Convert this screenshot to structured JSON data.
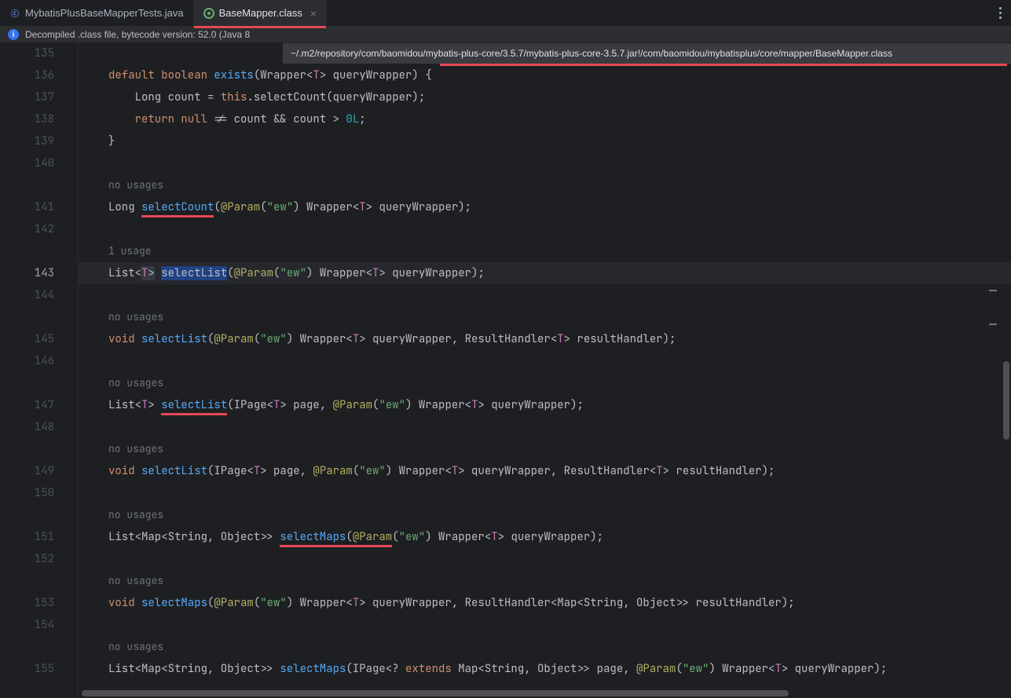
{
  "tabs": [
    {
      "label": "MybatisPlusBaseMapperTests.java",
      "active": false,
      "icon": "class"
    },
    {
      "label": "BaseMapper.class",
      "active": true,
      "icon": "decompiled",
      "closable": true
    }
  ],
  "banner": {
    "text": "Decompiled .class file, bytecode version: 52.0 (Java 8"
  },
  "tooltip": "~/.m2/repository/com/baomidou/mybatis-plus-core/3.5.7/mybatis-plus-core-3.5.7.jar!/com/baomidou/mybatisplus/core/mapper/BaseMapper.class",
  "lines": [
    {
      "n": 135,
      "segs": []
    },
    {
      "n": 136,
      "segs": [
        {
          "t": "default ",
          "c": "kw"
        },
        {
          "t": "boolean ",
          "c": "kw"
        },
        {
          "t": "exists",
          "c": "fn"
        },
        {
          "t": "(Wrapper<",
          "c": "pun"
        },
        {
          "t": "T",
          "c": "type"
        },
        {
          "t": "> queryWrapper) {",
          "c": "pun"
        }
      ]
    },
    {
      "n": 137,
      "segs": [
        {
          "t": "    Long count = ",
          "c": "name"
        },
        {
          "t": "this",
          "c": "this"
        },
        {
          "t": ".selectCount(queryWrapper);",
          "c": "name"
        }
      ]
    },
    {
      "n": 138,
      "segs": [
        {
          "t": "    ",
          "c": "name"
        },
        {
          "t": "return ",
          "c": "kw"
        },
        {
          "t": "null ",
          "c": "kw"
        },
        {
          "t": "!= count && count > ",
          "c": "name"
        },
        {
          "t": "0L",
          "c": "num"
        },
        {
          "t": ";",
          "c": "pun"
        }
      ]
    },
    {
      "n": 139,
      "segs": [
        {
          "t": "}",
          "c": "pun"
        }
      ]
    },
    {
      "n": 140,
      "segs": []
    },
    {
      "n": null,
      "segs": [
        {
          "t": "no usages",
          "c": "hint"
        }
      ]
    },
    {
      "n": 141,
      "segs": [
        {
          "t": "Long ",
          "c": "name"
        },
        {
          "t": "selectCount",
          "c": "fn",
          "u": true
        },
        {
          "t": "(",
          "c": "pun"
        },
        {
          "t": "@Param",
          "c": "ann"
        },
        {
          "t": "(",
          "c": "pun"
        },
        {
          "t": "\"ew\"",
          "c": "str"
        },
        {
          "t": ") Wrapper<",
          "c": "pun"
        },
        {
          "t": "T",
          "c": "type"
        },
        {
          "t": "> queryWrapper);",
          "c": "pun"
        }
      ]
    },
    {
      "n": 142,
      "segs": []
    },
    {
      "n": null,
      "segs": [
        {
          "t": "1 usage",
          "c": "hint"
        }
      ]
    },
    {
      "n": 143,
      "sel": true,
      "segs": [
        {
          "t": "List<",
          "c": "name"
        },
        {
          "t": "T",
          "c": "type",
          "box": true
        },
        {
          "t": ">",
          "c": "name",
          "box": true
        },
        {
          "t": " ",
          "c": "name"
        },
        {
          "t": "selectList",
          "c": "fn",
          "hl": true
        },
        {
          "t": "(",
          "c": "pun"
        },
        {
          "t": "@Param",
          "c": "ann"
        },
        {
          "t": "(",
          "c": "pun"
        },
        {
          "t": "\"ew\"",
          "c": "str"
        },
        {
          "t": ") Wrapper<",
          "c": "pun"
        },
        {
          "t": "T",
          "c": "type"
        },
        {
          "t": "> queryWrapper);",
          "c": "pun"
        }
      ]
    },
    {
      "n": 144,
      "segs": []
    },
    {
      "n": null,
      "segs": [
        {
          "t": "no usages",
          "c": "hint"
        }
      ]
    },
    {
      "n": 145,
      "segs": [
        {
          "t": "void ",
          "c": "kw"
        },
        {
          "t": "selectList",
          "c": "fn"
        },
        {
          "t": "(",
          "c": "pun"
        },
        {
          "t": "@Param",
          "c": "ann"
        },
        {
          "t": "(",
          "c": "pun"
        },
        {
          "t": "\"ew\"",
          "c": "str"
        },
        {
          "t": ") Wrapper<",
          "c": "pun"
        },
        {
          "t": "T",
          "c": "type"
        },
        {
          "t": "> queryWrapper, ResultHandler<",
          "c": "pun"
        },
        {
          "t": "T",
          "c": "type"
        },
        {
          "t": "> resultHandler);",
          "c": "pun"
        }
      ]
    },
    {
      "n": 146,
      "segs": []
    },
    {
      "n": null,
      "segs": [
        {
          "t": "no usages",
          "c": "hint"
        }
      ]
    },
    {
      "n": 147,
      "segs": [
        {
          "t": "List<",
          "c": "name"
        },
        {
          "t": "T",
          "c": "type"
        },
        {
          "t": "> ",
          "c": "name"
        },
        {
          "t": "selectList",
          "c": "fn",
          "u": true
        },
        {
          "t": "(IPage<",
          "c": "pun"
        },
        {
          "t": "T",
          "c": "type"
        },
        {
          "t": "> page, ",
          "c": "pun"
        },
        {
          "t": "@Param",
          "c": "ann"
        },
        {
          "t": "(",
          "c": "pun"
        },
        {
          "t": "\"ew\"",
          "c": "str"
        },
        {
          "t": ") Wrapper<",
          "c": "pun"
        },
        {
          "t": "T",
          "c": "type"
        },
        {
          "t": "> queryWrapper);",
          "c": "pun"
        }
      ]
    },
    {
      "n": 148,
      "segs": []
    },
    {
      "n": null,
      "segs": [
        {
          "t": "no usages",
          "c": "hint"
        }
      ]
    },
    {
      "n": 149,
      "segs": [
        {
          "t": "void ",
          "c": "kw"
        },
        {
          "t": "selectList",
          "c": "fn"
        },
        {
          "t": "(IPage<",
          "c": "pun"
        },
        {
          "t": "T",
          "c": "type"
        },
        {
          "t": "> page, ",
          "c": "pun"
        },
        {
          "t": "@Param",
          "c": "ann"
        },
        {
          "t": "(",
          "c": "pun"
        },
        {
          "t": "\"ew\"",
          "c": "str"
        },
        {
          "t": ") Wrapper<",
          "c": "pun"
        },
        {
          "t": "T",
          "c": "type"
        },
        {
          "t": "> queryWrapper, ResultHandler<",
          "c": "pun"
        },
        {
          "t": "T",
          "c": "type"
        },
        {
          "t": "> resultHandler);",
          "c": "pun"
        }
      ]
    },
    {
      "n": 150,
      "segs": []
    },
    {
      "n": null,
      "segs": [
        {
          "t": "no usages",
          "c": "hint"
        }
      ]
    },
    {
      "n": 151,
      "segs": [
        {
          "t": "List<Map<String, Object>> ",
          "c": "name"
        },
        {
          "t": "selectMaps",
          "c": "fn",
          "u": true
        },
        {
          "t": "(",
          "c": "pun",
          "u": true
        },
        {
          "t": "@Param",
          "c": "ann",
          "u": true
        },
        {
          "t": "(",
          "c": "pun"
        },
        {
          "t": "\"ew\"",
          "c": "str"
        },
        {
          "t": ") Wrapper<",
          "c": "pun"
        },
        {
          "t": "T",
          "c": "type"
        },
        {
          "t": "> queryWrapper);",
          "c": "pun"
        }
      ]
    },
    {
      "n": 152,
      "segs": []
    },
    {
      "n": null,
      "segs": [
        {
          "t": "no usages",
          "c": "hint"
        }
      ]
    },
    {
      "n": 153,
      "segs": [
        {
          "t": "void ",
          "c": "kw"
        },
        {
          "t": "selectMaps",
          "c": "fn"
        },
        {
          "t": "(",
          "c": "pun"
        },
        {
          "t": "@Param",
          "c": "ann"
        },
        {
          "t": "(",
          "c": "pun"
        },
        {
          "t": "\"ew\"",
          "c": "str"
        },
        {
          "t": ") Wrapper<",
          "c": "pun"
        },
        {
          "t": "T",
          "c": "type"
        },
        {
          "t": "> queryWrapper, ResultHandler<Map<String, Object>> resultHandler);",
          "c": "pun"
        }
      ]
    },
    {
      "n": 154,
      "segs": []
    },
    {
      "n": null,
      "segs": [
        {
          "t": "no usages",
          "c": "hint"
        }
      ]
    },
    {
      "n": 155,
      "segs": [
        {
          "t": "List<Map<String, Object>> ",
          "c": "name"
        },
        {
          "t": "selectMaps",
          "c": "fn"
        },
        {
          "t": "(IPage<? ",
          "c": "pun"
        },
        {
          "t": "extends",
          "c": "kw"
        },
        {
          "t": " Map<String, Object>> page, ",
          "c": "pun"
        },
        {
          "t": "@Param",
          "c": "ann"
        },
        {
          "t": "(",
          "c": "pun"
        },
        {
          "t": "\"ew\"",
          "c": "str"
        },
        {
          "t": ") Wrapper<",
          "c": "pun"
        },
        {
          "t": "T",
          "c": "type"
        },
        {
          "t": "> queryWrapper);",
          "c": "pun"
        }
      ]
    }
  ]
}
